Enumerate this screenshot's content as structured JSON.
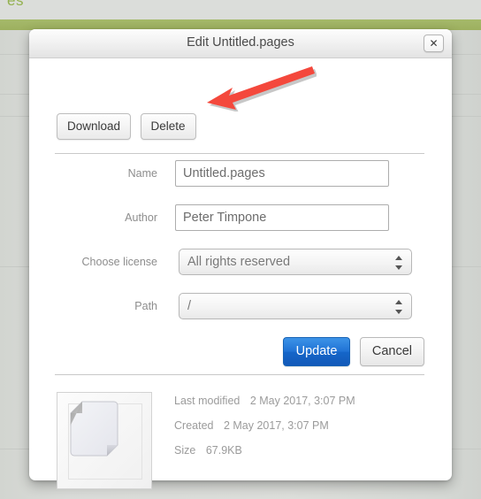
{
  "background": {
    "top_text": "es",
    "green_bar_color": "#a0b461",
    "page_bg_color": "#dbddda",
    "row_separator_color": "#c6c9c5",
    "row_line_tops": [
      61,
      106,
      131,
      301,
      507
    ]
  },
  "dialog": {
    "title": "Edit Untitled.pages",
    "close_icon": "close-icon",
    "close_glyph": "✕",
    "actions": {
      "download_label": "Download",
      "delete_label": "Delete"
    },
    "form": [
      {
        "label": "Name",
        "type": "text",
        "value": "Untitled.pages",
        "name": "name-field"
      },
      {
        "label": "Author",
        "type": "text",
        "value": "Peter Timpone",
        "name": "author-field"
      },
      {
        "label": "Choose license",
        "type": "select",
        "value": "All rights reserved",
        "name": "license-select"
      },
      {
        "label": "Path",
        "type": "select",
        "value": "/",
        "name": "path-select"
      }
    ],
    "submit": {
      "update_label": "Update",
      "cancel_label": "Cancel",
      "update_color": "#1f72d4"
    },
    "file_info": {
      "thumbnail_icon": "document-file-icon",
      "rows": [
        {
          "key": "Last modified",
          "value": "2 May 2017, 3:07 PM"
        },
        {
          "key": "Created",
          "value": "2 May 2017, 3:07 PM"
        },
        {
          "key": "Size",
          "value": "67.9KB"
        }
      ]
    }
  },
  "annotation": {
    "arrow_color": "#f4483c",
    "arrow_direction": "left",
    "points_at": "Delete"
  }
}
